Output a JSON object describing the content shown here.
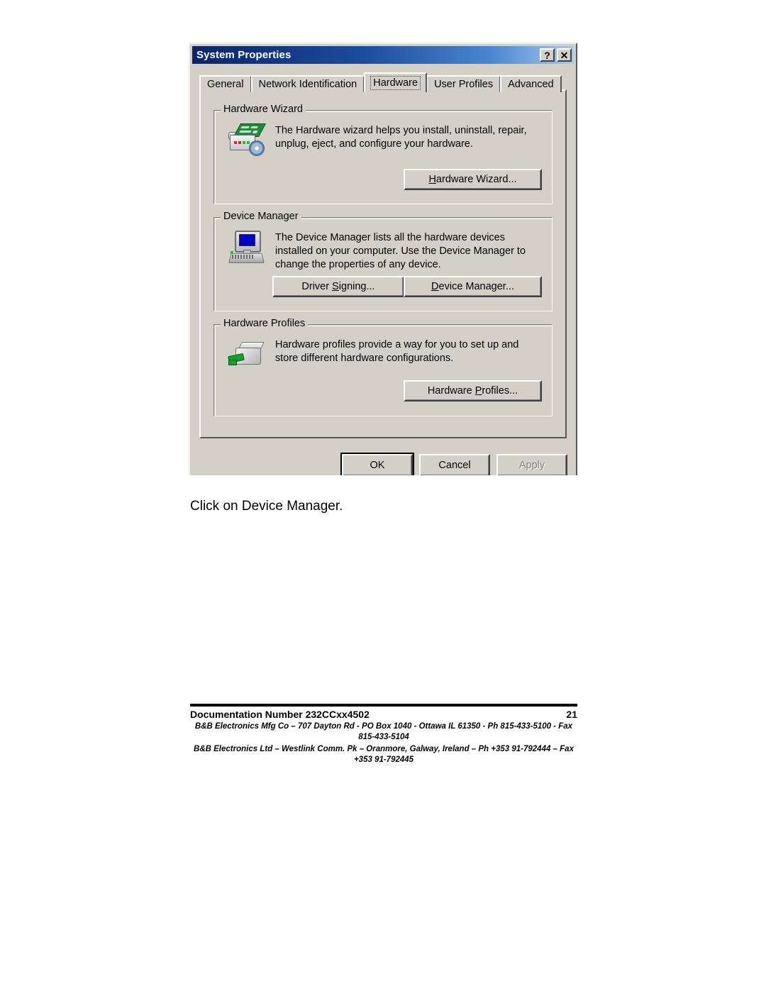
{
  "document": {
    "caption": "Click on Device Manager.",
    "footer": {
      "doc_number": "Documentation Number 232CCxx4502",
      "page_number": "21",
      "address_line_1": "B&B Electronics Mfg Co – 707 Dayton Rd - PO Box 1040 - Ottawa IL 61350 - Ph 815-433-5100 - Fax 815-433-5104",
      "address_line_2": "B&B Electronics Ltd – Westlink Comm. Pk – Oranmore, Galway, Ireland – Ph +353 91-792444 – Fax +353 91-792445"
    }
  },
  "dialog": {
    "title": "System Properties",
    "titlebar_buttons": {
      "help": "?",
      "close": "✕"
    },
    "colors": {
      "titlebar_start": "#0a246a",
      "titlebar_end": "#a6caf0",
      "face": "#d4d0c8",
      "screen_blue": "#0000c8",
      "board_green": "#1e8a3c"
    },
    "tabs": [
      {
        "label": "General",
        "selected": false
      },
      {
        "label": "Network Identification",
        "selected": false
      },
      {
        "label": "Hardware",
        "selected": true
      },
      {
        "label": "User Profiles",
        "selected": false
      },
      {
        "label": "Advanced",
        "selected": false
      }
    ],
    "groups": [
      {
        "title": "Hardware Wizard",
        "icon": "hardware-wizard-icon",
        "description": "The Hardware wizard helps you install, uninstall, repair, unplug, eject, and configure your hardware.",
        "buttons": [
          {
            "label_pre": "H",
            "label_post": "ardware Wizard...",
            "enabled": true
          }
        ]
      },
      {
        "title": "Device Manager",
        "icon": "computer-icon",
        "description": "The Device Manager lists all the hardware devices installed on your computer. Use the Device Manager to change the properties of any device.",
        "buttons": [
          {
            "label_pre": "S",
            "label_post": "igning...",
            "prefix": "Driver ",
            "enabled": true
          },
          {
            "label_pre": "D",
            "label_post": "evice Manager...",
            "enabled": true
          }
        ]
      },
      {
        "title": "Hardware Profiles",
        "icon": "hardware-profiles-icon",
        "description": "Hardware profiles provide a way for you to set up and store different hardware configurations.",
        "buttons": [
          {
            "label_pre": "P",
            "label_post": "rofiles...",
            "prefix": "Hardware ",
            "enabled": true
          }
        ]
      }
    ],
    "bottom_buttons": [
      {
        "label": "OK",
        "state": "default"
      },
      {
        "label": "Cancel",
        "state": "normal"
      },
      {
        "label": "Apply",
        "state": "disabled"
      }
    ]
  }
}
